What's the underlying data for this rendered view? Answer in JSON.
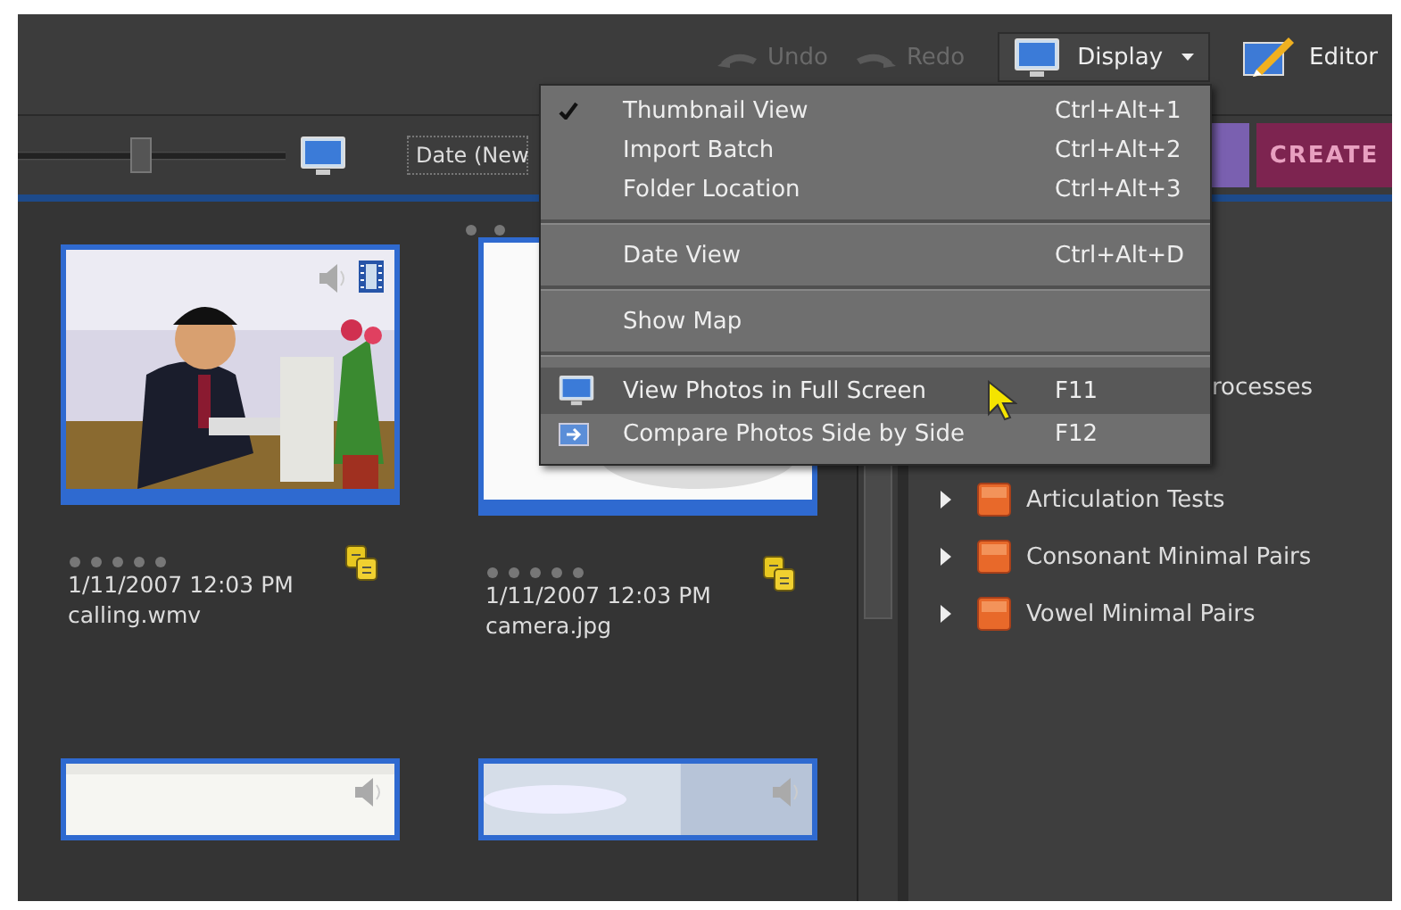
{
  "toolbar": {
    "undo": "Undo",
    "redo": "Redo",
    "display": "Display",
    "editor": "Editor"
  },
  "options_bar": {
    "slider": {
      "level": 0.46
    },
    "sort": "Date (New",
    "create_tab": "CREATE"
  },
  "display_menu": {
    "groups": [
      {
        "items": [
          {
            "label": "Thumbnail View",
            "shortcut": "Ctrl+Alt+1",
            "checked": true,
            "highlighted": false
          },
          {
            "label": "Import Batch",
            "shortcut": "Ctrl+Alt+2",
            "checked": false,
            "highlighted": false
          },
          {
            "label": "Folder Location",
            "shortcut": "Ctrl+Alt+3",
            "checked": false,
            "highlighted": false
          }
        ]
      },
      {
        "items": [
          {
            "label": "Date View",
            "shortcut": "Ctrl+Alt+D",
            "checked": false,
            "highlighted": false
          }
        ]
      },
      {
        "items": [
          {
            "label": "Show Map",
            "checked": false,
            "highlighted": false
          }
        ]
      },
      {
        "items": [
          {
            "label": "View Photos in Full Screen",
            "shortcut": "F11",
            "checked": false,
            "highlighted": true
          },
          {
            "label": "Compare Photos Side by Side",
            "shortcut": "F12",
            "checked": false,
            "highlighted": false
          }
        ]
      }
    ]
  },
  "thumbnails": [
    {
      "kind": "video",
      "stars": 0,
      "date": "1/11/2007 12:03 PM",
      "name": "calling.wmv"
    },
    {
      "stars": 0,
      "date": "1/11/2007 12:03 PM",
      "name": "camera.jpg"
    },
    {
      "kind": "audio"
    },
    {
      "kind": "audio"
    }
  ],
  "albums": [
    {
      "kind": "text",
      "label": "rocesses"
    },
    {
      "kind": "folder",
      "label": "Articulation Tests",
      "expanded": false
    },
    {
      "kind": "folder",
      "label": "Consonant Minimal Pairs",
      "expanded": false
    },
    {
      "kind": "folder",
      "label": "Vowel Minimal Pairs",
      "expanded": false
    }
  ]
}
